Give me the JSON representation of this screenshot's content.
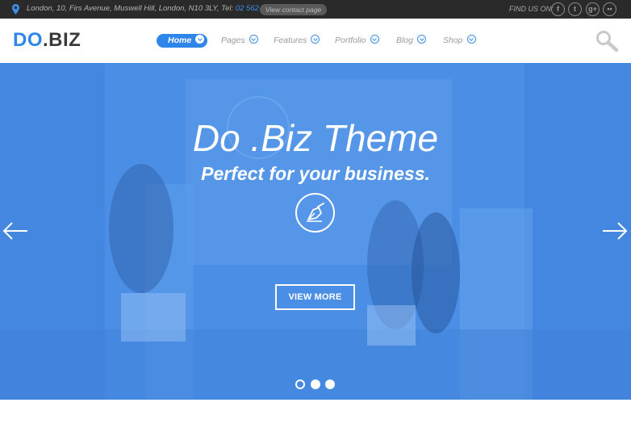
{
  "topbar": {
    "address": "London, 10, Firs Avenue, Muswell Hill, London, N10 3LY, Tel:",
    "phone": "02 562-958",
    "contact_button": "View contact page",
    "find_us": "FIND US ON:",
    "social": [
      {
        "name": "facebook-icon",
        "glyph": "f"
      },
      {
        "name": "twitter-icon",
        "glyph": "t"
      },
      {
        "name": "google-plus-icon",
        "glyph": "g+"
      },
      {
        "name": "flickr-icon",
        "glyph": "••"
      }
    ]
  },
  "header": {
    "logo_do": "DO",
    "logo_biz": ".BIZ",
    "nav": [
      "Home",
      "Pages",
      "Features",
      "Portfolio",
      "Blog",
      "Shop"
    ],
    "active_nav": "Home"
  },
  "hero": {
    "title": "Do .Biz Theme",
    "subtitle": "Perfect for your business.",
    "cta": "VIEW MORE",
    "slides_total": 3,
    "active_slide": 1
  },
  "colors": {
    "accent": "#2f86ea",
    "hero_overlay": "#4a8ee6",
    "topbar": "#2a2a2a"
  }
}
